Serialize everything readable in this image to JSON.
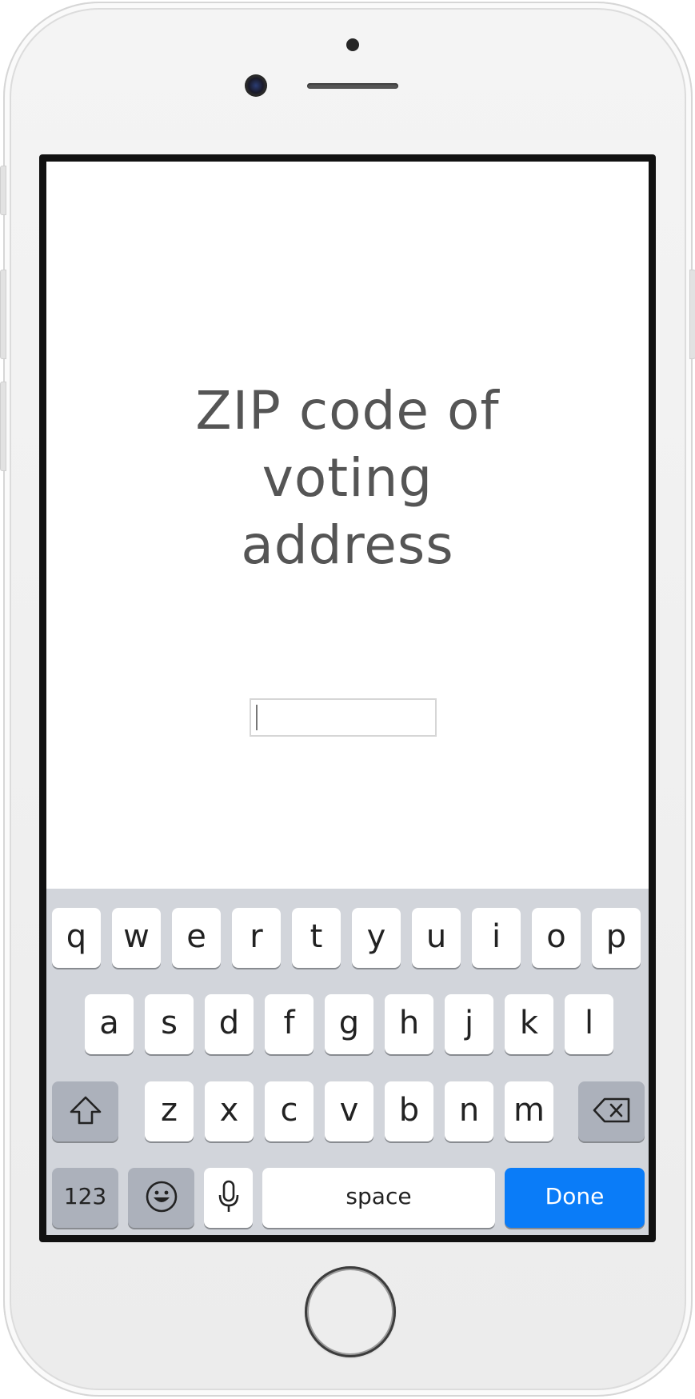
{
  "screen": {
    "prompt_lines": [
      "ZIP code of",
      "voting",
      "address"
    ],
    "zip_input": {
      "value": "",
      "placeholder": ""
    }
  },
  "keyboard": {
    "row1": [
      "q",
      "w",
      "e",
      "r",
      "t",
      "y",
      "u",
      "i",
      "o",
      "p"
    ],
    "row2": [
      "a",
      "s",
      "d",
      "f",
      "g",
      "h",
      "j",
      "k",
      "l"
    ],
    "row3": [
      "z",
      "x",
      "c",
      "v",
      "b",
      "n",
      "m"
    ],
    "numbers_label": "123",
    "space_label": "space",
    "done_label": "Done",
    "icons": {
      "shift": "shift-arrow-icon",
      "delete": "backspace-icon",
      "emoji": "emoji-smiley-icon",
      "mic": "microphone-icon"
    }
  },
  "colors": {
    "done_key": "#0a7cf8",
    "keyboard_bg": "#d2d5db",
    "prompt_text": "#555555"
  }
}
